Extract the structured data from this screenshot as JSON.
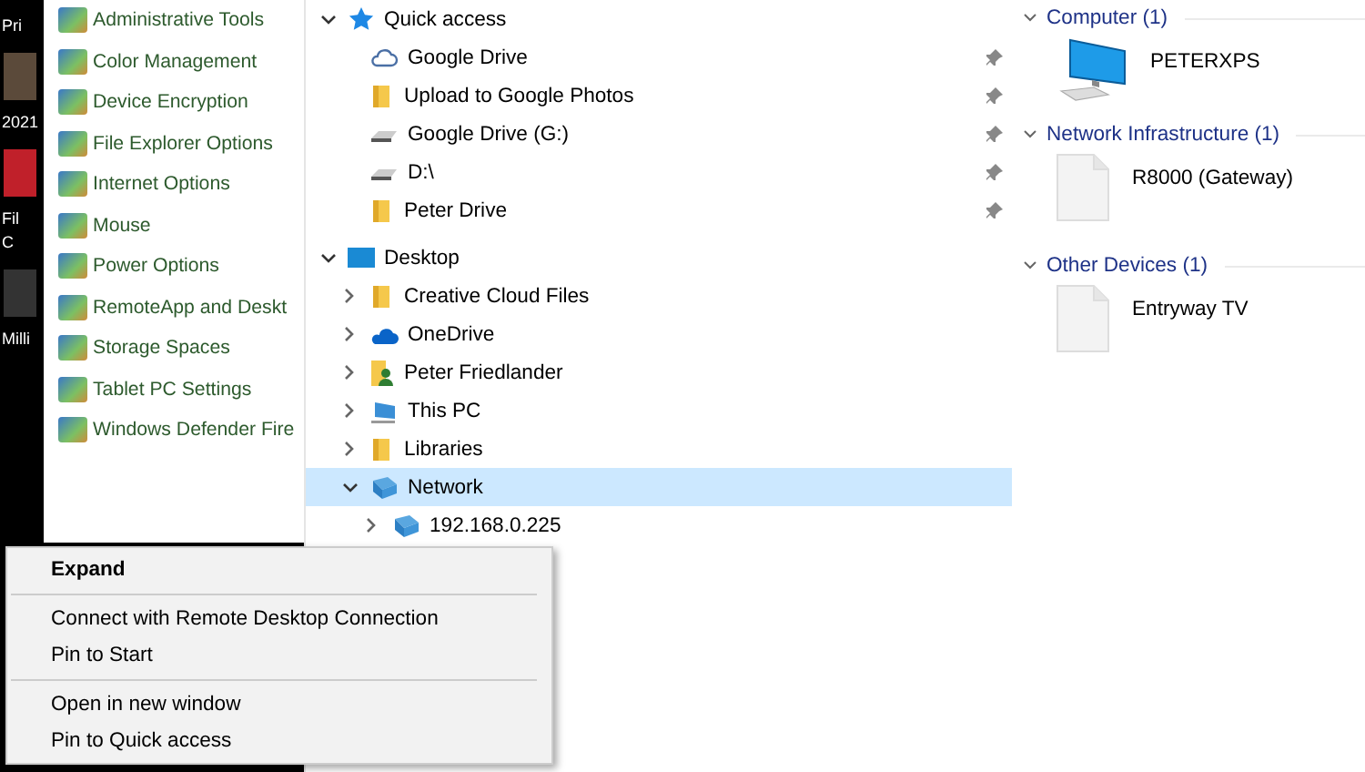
{
  "desktop": {
    "icon_labels": [
      "Pri",
      "2021",
      "Fil",
      "C",
      "Milli"
    ]
  },
  "control_panel": {
    "items": [
      {
        "label": "Administrative Tools"
      },
      {
        "label": "Color Management"
      },
      {
        "label": "Device Encryption"
      },
      {
        "label": "File Explorer Options"
      },
      {
        "label": "Internet Options"
      },
      {
        "label": "Mouse"
      },
      {
        "label": "Power Options"
      },
      {
        "label": "RemoteApp and Deskt"
      },
      {
        "label": "Storage Spaces"
      },
      {
        "label": "Tablet PC Settings"
      },
      {
        "label": "Windows Defender Fire"
      }
    ]
  },
  "navigation_pane": {
    "tree": [
      {
        "label": "Quick access",
        "kind": "star",
        "expanded": true,
        "selected": false,
        "children": [
          {
            "label": "Google Drive",
            "kind": "cloud-outline",
            "pinned": true,
            "selected": false
          },
          {
            "label": "Upload to Google Photos",
            "kind": "folder",
            "pinned": true,
            "selected": false
          },
          {
            "label": "Google Drive (G:)",
            "kind": "drive",
            "pinned": true,
            "selected": false
          },
          {
            "label": "D:\\",
            "kind": "drive",
            "pinned": true,
            "selected": false
          },
          {
            "label": "Peter Drive",
            "kind": "folder",
            "pinned": true,
            "selected": false
          }
        ]
      },
      {
        "label": "Desktop",
        "kind": "desktop",
        "expanded": true,
        "selected": false,
        "children": [
          {
            "label": "Creative Cloud Files",
            "kind": "folder",
            "expanded": false,
            "selected": false
          },
          {
            "label": "OneDrive",
            "kind": "cloud",
            "expanded": false,
            "selected": false
          },
          {
            "label": "Peter Friedlander",
            "kind": "user",
            "expanded": false,
            "selected": false
          },
          {
            "label": "This PC",
            "kind": "pc",
            "expanded": false,
            "selected": false
          },
          {
            "label": "Libraries",
            "kind": "folder",
            "expanded": false,
            "selected": false
          },
          {
            "label": "Network",
            "kind": "network",
            "expanded": true,
            "selected": true,
            "children": [
              {
                "label": "192.168.0.225",
                "kind": "network",
                "expanded": false,
                "selected": false
              }
            ]
          }
        ]
      }
    ]
  },
  "content_pane": {
    "groups": [
      {
        "title": "Computer (1)",
        "items": [
          {
            "label": "PETERXPS",
            "kind": "computer"
          }
        ]
      },
      {
        "title": "Network Infrastructure (1)",
        "items": [
          {
            "label": "R8000 (Gateway)",
            "kind": "file"
          }
        ]
      },
      {
        "title": "Other Devices (1)",
        "items": [
          {
            "label": "Entryway TV",
            "kind": "file"
          }
        ]
      }
    ]
  },
  "context_menu": {
    "sections": [
      [
        {
          "label": "Expand",
          "default": true
        }
      ],
      [
        {
          "label": "Connect with Remote Desktop Connection",
          "default": false
        },
        {
          "label": "Pin to Start",
          "default": false
        }
      ],
      [
        {
          "label": "Open in new window",
          "default": false
        },
        {
          "label": "Pin to Quick access",
          "default": false
        }
      ]
    ]
  }
}
